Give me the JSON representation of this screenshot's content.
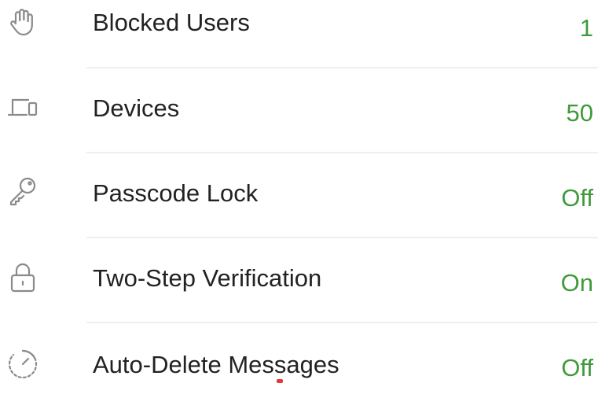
{
  "settings": {
    "accent_value_color": "#3f9a3a",
    "icon_color": "#8a8a8a",
    "items": [
      {
        "label": "Blocked Users",
        "value": "1",
        "icon": "hand-stop-icon"
      },
      {
        "label": "Devices",
        "value": "50",
        "icon": "devices-icon"
      },
      {
        "label": "Passcode Lock",
        "value": "Off",
        "icon": "key-icon"
      },
      {
        "label": "Two-Step Verification",
        "value": "On",
        "icon": "lock-icon"
      },
      {
        "label": "Auto-Delete Messages",
        "value": "Off",
        "icon": "timer-icon"
      }
    ]
  }
}
